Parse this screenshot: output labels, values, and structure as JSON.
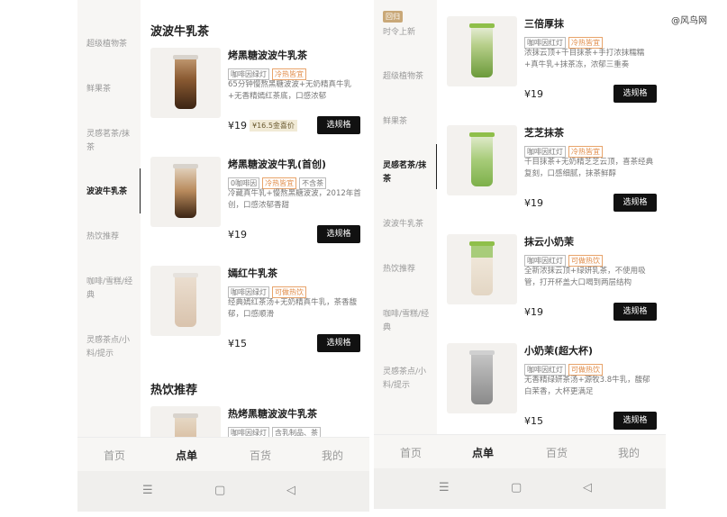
{
  "watermark": "@风鸟网",
  "left": {
    "sidebar": [
      {
        "label": "超级植物茶"
      },
      {
        "label": "鲜果茶"
      },
      {
        "label": "灵感茗茶/抹茶"
      },
      {
        "label": "波波牛乳茶",
        "active": true
      },
      {
        "label": "热饮推荐"
      },
      {
        "label": "咖啡/雪糕/经典"
      },
      {
        "label": "灵感茶点/小料/提示"
      }
    ],
    "section1": "波波牛乳茶",
    "section2": "热饮推荐",
    "products": [
      {
        "name": "烤黑糖波波牛乳茶",
        "tags": [
          "咖啡因绿灯",
          "冷热皆宜"
        ],
        "desc": "65分钟慢熬黑糖波波+无奶精真牛乳+无香精嫣红茶底，口感浓郁",
        "price": "¥19",
        "gold": "¥16.5金喜价",
        "button": "选规格"
      },
      {
        "name": "烤黑糖波波牛乳(首创)",
        "tags": [
          "0咖啡因",
          "冷热皆宜",
          "不含茶"
        ],
        "desc": "冷藏真牛乳+慢熬黑糖波波，2012年首创，口感浓郁香甜",
        "price": "¥19",
        "button": "选规格"
      },
      {
        "name": "嫣红牛乳茶",
        "tags": [
          "咖啡因绿灯",
          "可做热饮"
        ],
        "desc": "经典嫣红茶汤+无奶精真牛乳，茶香馥郁，口感顺滑",
        "price": "¥15",
        "button": "选规格"
      },
      {
        "name": "热烤黑糖波波牛乳茶",
        "tags": [
          "咖啡因绿灯",
          "含乳制品、茶"
        ]
      }
    ],
    "tabs": [
      "首页",
      "点单",
      "百货",
      "我的"
    ]
  },
  "right": {
    "badge": "回归",
    "sidebar": [
      {
        "label": "时令上新"
      },
      {
        "label": "超级植物茶"
      },
      {
        "label": "鲜果茶"
      },
      {
        "label": "灵感茗茶/抹茶",
        "active": true
      },
      {
        "label": "波波牛乳茶"
      },
      {
        "label": "热饮推荐"
      },
      {
        "label": "咖啡/雪糕/经典"
      },
      {
        "label": "灵感茶点/小料/提示"
      }
    ],
    "products": [
      {
        "name": "三倍厚抹",
        "tags": [
          "咖啡因红灯",
          "冷热皆宜"
        ],
        "desc": "浓抹云顶+千目抹茶+手打浓抹糯糯+真牛乳+抹茶冻，浓郁三重奏",
        "price": "¥19",
        "button": "选规格"
      },
      {
        "name": "芝芝抹茶",
        "tags": [
          "咖啡因红灯",
          "冷热皆宜"
        ],
        "desc": "千目抹茶+无奶精芝芝云顶，喜茶经典复刻，口感细腻，抹茶鲜醇",
        "price": "¥19",
        "button": "选规格"
      },
      {
        "name": "抹云小奶茉",
        "tags": [
          "咖啡因红灯",
          "可做热饮"
        ],
        "desc": "全新浓抹云顶+绿妍乳茶，不使用吸管，打开杯盖大口喝到两层结构",
        "price": "¥19",
        "button": "选规格"
      },
      {
        "name": "小奶茉(超大杯)",
        "tags": [
          "咖啡因红灯",
          "可做热饮"
        ],
        "desc": "无香精绿妍茶汤+源牧3.8牛乳，馥郁白茉香，大杯更满足",
        "price": "¥15",
        "button": "选规格"
      }
    ],
    "tabs": [
      "首页",
      "点单",
      "百货",
      "我的"
    ]
  },
  "system_nav": [
    "☰",
    "▢",
    "◁"
  ]
}
